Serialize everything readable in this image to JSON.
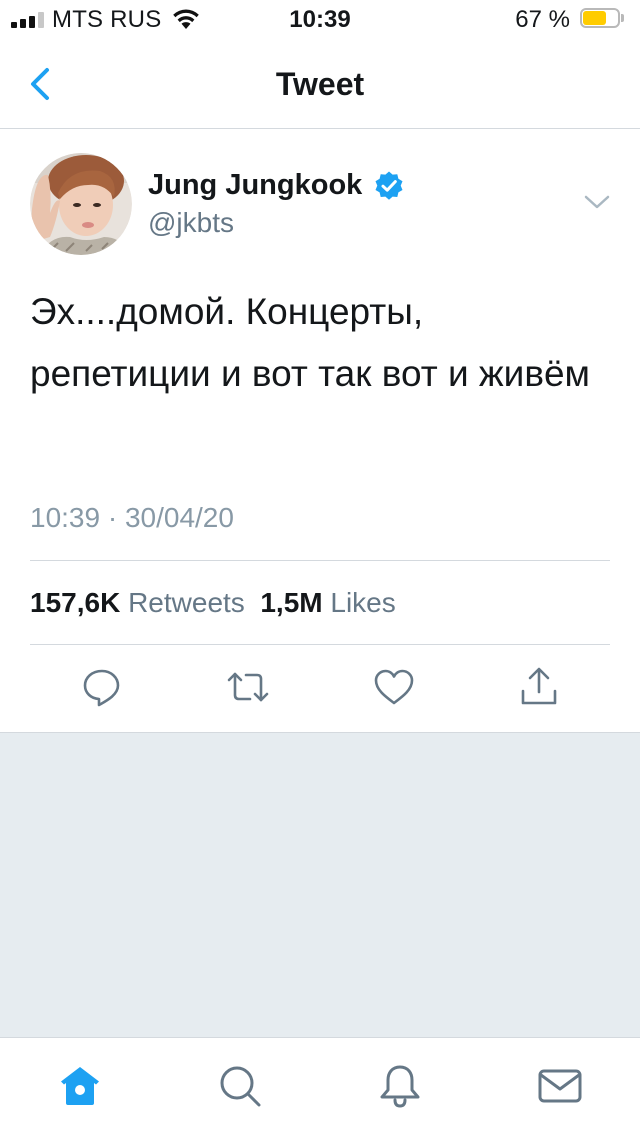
{
  "status_bar": {
    "carrier": "MTS RUS",
    "time": "10:39",
    "battery_text": "67 %",
    "battery_level": 0.67,
    "signal_bars_filled": 3,
    "signal_bars_total": 4
  },
  "nav": {
    "title": "Tweet",
    "back_icon": "chevron-left-icon"
  },
  "tweet": {
    "author_name": "Jung Jungkook",
    "author_handle": "@jkbts",
    "verified": true,
    "text": "Эх....домой. Концерты, репетиции и вот так вот и живём",
    "timestamp": "10:39 · 30/04/20",
    "retweets_count": "157,6K",
    "retweets_label": "Retweets",
    "likes_count": "1,5M",
    "likes_label": "Likes",
    "actions": [
      "reply-icon",
      "retweet-icon",
      "like-icon",
      "share-icon"
    ]
  },
  "tabs": [
    {
      "icon": "home-icon",
      "active": true
    },
    {
      "icon": "search-icon",
      "active": false
    },
    {
      "icon": "notifications-icon",
      "active": false
    },
    {
      "icon": "messages-icon",
      "active": false
    }
  ],
  "colors": {
    "accent": "#1da1f2",
    "battery_fill": "#ffcc00",
    "icon_gray": "#657786",
    "background": "#e6ecf0"
  }
}
